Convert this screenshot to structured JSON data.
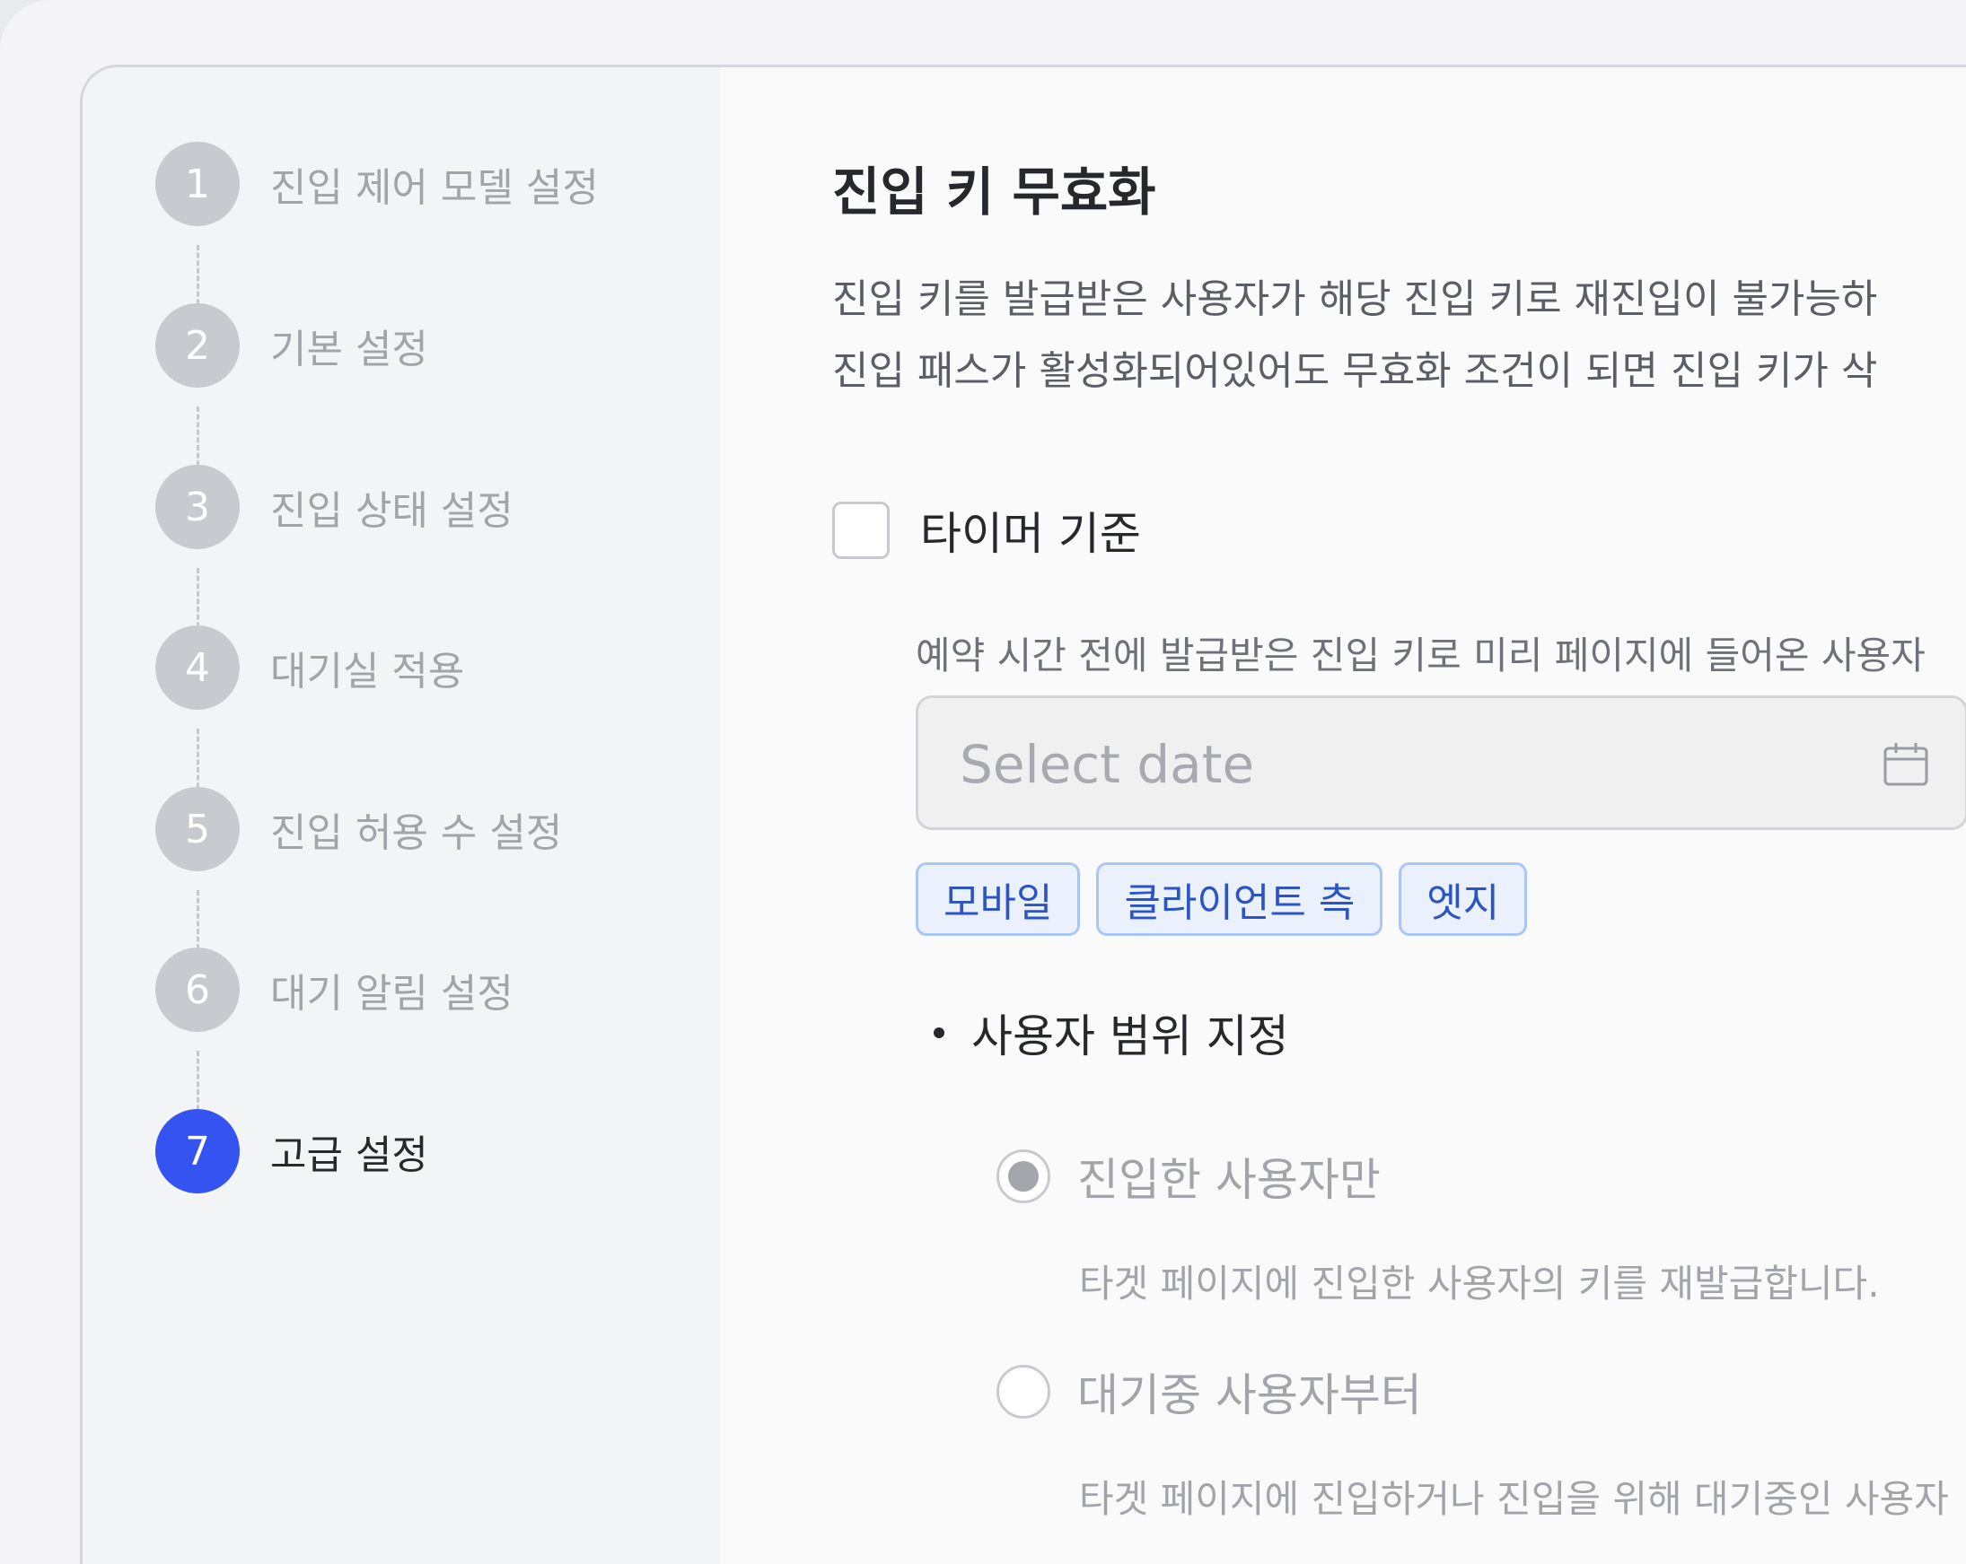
{
  "sidebar": {
    "steps": [
      {
        "number": "1",
        "label": "진입 제어 모델 설정"
      },
      {
        "number": "2",
        "label": "기본 설정"
      },
      {
        "number": "3",
        "label": "진입 상태 설정"
      },
      {
        "number": "4",
        "label": "대기실 적용"
      },
      {
        "number": "5",
        "label": "진입 허용 수 설정"
      },
      {
        "number": "6",
        "label": "대기 알림 설정"
      },
      {
        "number": "7",
        "label": "고급 설정"
      }
    ],
    "active_step": "7"
  },
  "main": {
    "title": "진입 키 무효화",
    "description_lines": [
      "진입 키를 발급받은 사용자가 해당 진입 키로 재진입이 불가능하",
      "진입 패스가 활성화되어있어도 무효화 조건이 되면 진입 키가 삭"
    ],
    "timer": {
      "checkbox_label": "타이머 기준",
      "checked": false,
      "description": "예약 시간 전에 발급받은 진입 키로 미리 페이지에 들어온 사용자",
      "date_placeholder": "Select date"
    },
    "tags": [
      "모바일",
      "클라이언트 측",
      "엣지"
    ],
    "scope": {
      "heading": "사용자 범위 지정",
      "options": [
        {
          "label": "진입한 사용자만",
          "description": "타겟 페이지에 진입한 사용자의 키를 재발급합니다.",
          "selected": true
        },
        {
          "label": "대기중 사용자부터",
          "description": "타겟 페이지에 진입하거나 진입을 위해 대기중인 사용자",
          "selected": false
        }
      ]
    }
  },
  "colors": {
    "accent": "#3553f0",
    "tag_text": "#2b54c6",
    "tag_border": "#a9c6f6",
    "tag_bg": "#eaf1fd"
  }
}
